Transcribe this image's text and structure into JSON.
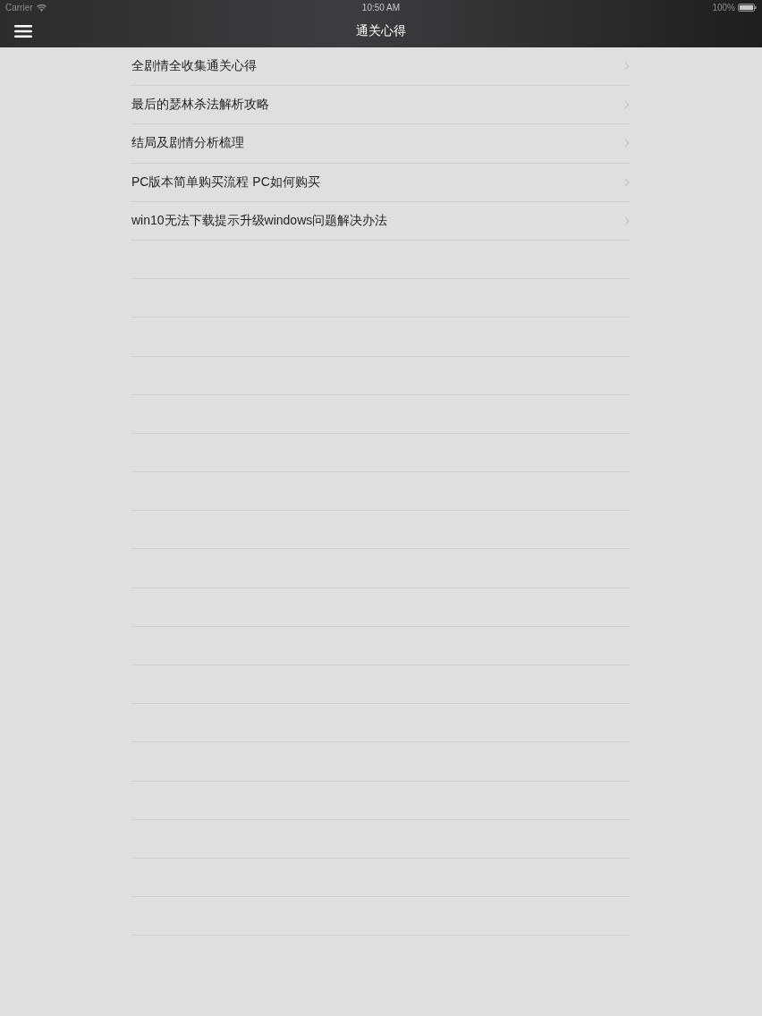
{
  "status_bar": {
    "carrier": "Carrier",
    "time": "10:50 AM",
    "battery": "100%"
  },
  "nav_bar": {
    "title": "通关心得"
  },
  "list": {
    "items": [
      {
        "title": "全剧情全收集通关心得"
      },
      {
        "title": "最后的瑟林杀法解析攻略"
      },
      {
        "title": "结局及剧情分析梳理"
      },
      {
        "title": "PC版本简单购买流程 PC如何购买"
      },
      {
        "title": "win10无法下载提示升级windows问题解决办法"
      }
    ]
  }
}
